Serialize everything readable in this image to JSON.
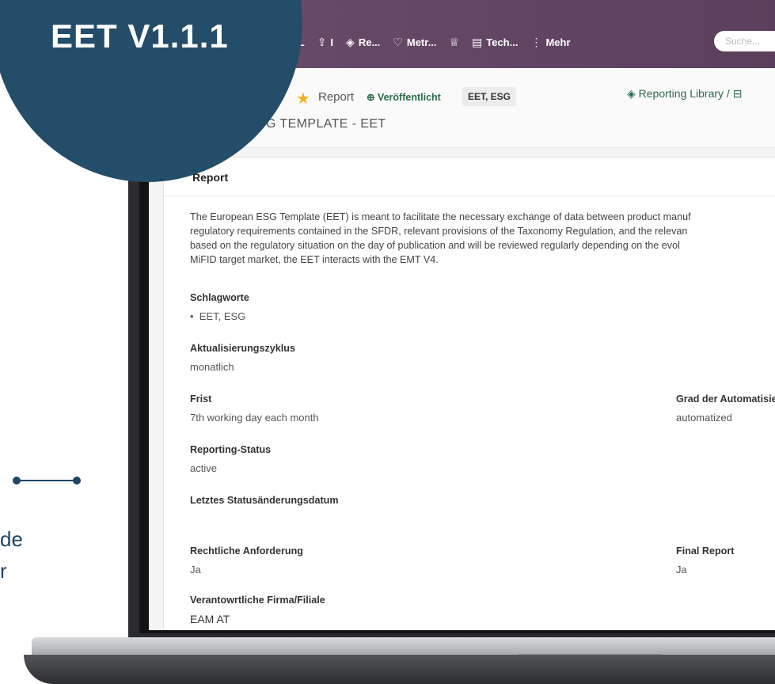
{
  "overlay": {
    "version_label": "EET V1.1.1"
  },
  "side_caption": [
    "de",
    "r"
  ],
  "nav": {
    "items": [
      {
        "label": "L",
        "icon": "upload-icon"
      },
      {
        "label": "I",
        "icon": "upload-icon"
      },
      {
        "label": "Re...",
        "icon": "gem-icon"
      },
      {
        "label": "Metr...",
        "icon": "heartbeat-icon"
      },
      {
        "label": "",
        "icon": "trophy-icon"
      },
      {
        "label": "Tech...",
        "icon": "database-icon"
      }
    ],
    "more_label": "Mehr",
    "search_placeholder": "Suche..."
  },
  "header": {
    "crumb": "Report",
    "status": "Veröffentlicht",
    "tag": "EET, ESG",
    "library_link": "Reporting Library /",
    "title": "G TEMPLATE - EET"
  },
  "card": {
    "title": "Report",
    "description_lines": [
      "The European ESG Template (EET) is meant to facilitate the necessary exchange of data between product manuf",
      "regulatory requirements contained in the SFDR, relevant provisions of the Taxonomy Regulation, and the relevan",
      "based on the regulatory situation on the day of publication and will be reviewed regularly depending on the evol",
      "MiFID target market, the EET interacts with the EMT V4."
    ],
    "fields": {
      "schlagworte_label": "Schlagworte",
      "schlagworte_value": "EET, ESG",
      "zyklus_label": "Aktualisierungszyklus",
      "zyklus_value": "monatlich",
      "frist_label": "Frist",
      "frist_value": "7th working day each month",
      "grad_label": "Grad der Automatisier",
      "grad_value": "automatized",
      "status_label": "Reporting-Status",
      "status_value": "active",
      "letztes_label": "Letztes Statusänderungsdatum",
      "rechtlich_label": "Rechtliche Anforderung",
      "rechtlich_value": "Ja",
      "final_label": "Final Report",
      "final_value": "Ja",
      "firma_label": "Verantowrtliche Firma/Filiale",
      "firma_value": "EAM AT"
    }
  }
}
